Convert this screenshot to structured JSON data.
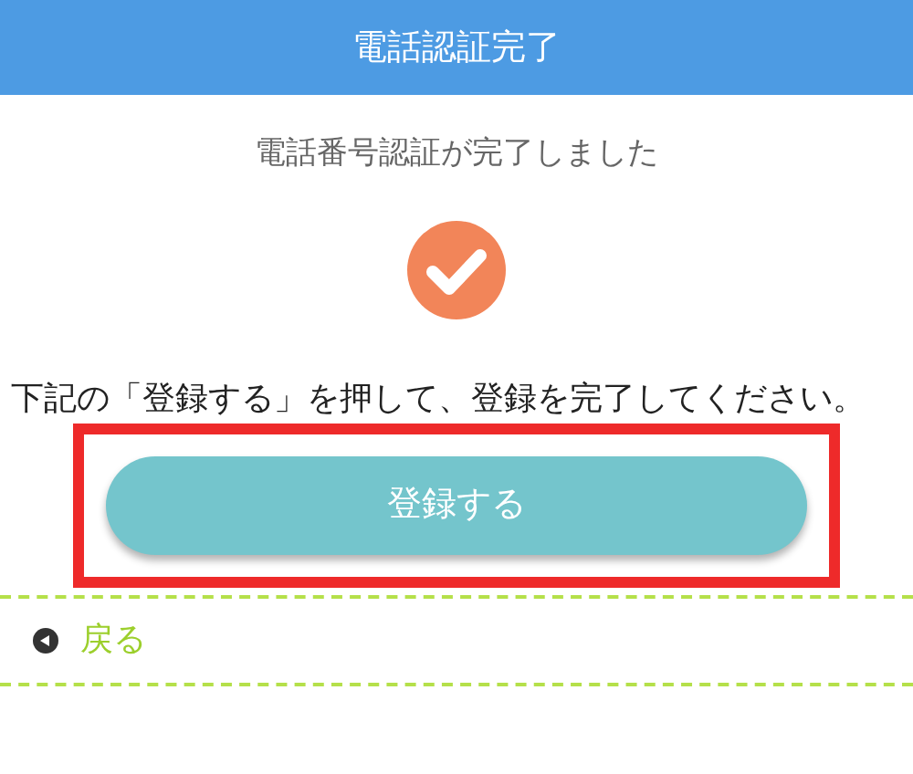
{
  "header": {
    "title": "電話認証完了"
  },
  "message": "電話番号認証が完了しました",
  "status": {
    "done": true
  },
  "instruction": "下記の「登録する」を押して、登録を完了してください。",
  "register_button": {
    "label": "登録する",
    "highlighted": true
  },
  "back_link": {
    "label": "戻る"
  }
}
